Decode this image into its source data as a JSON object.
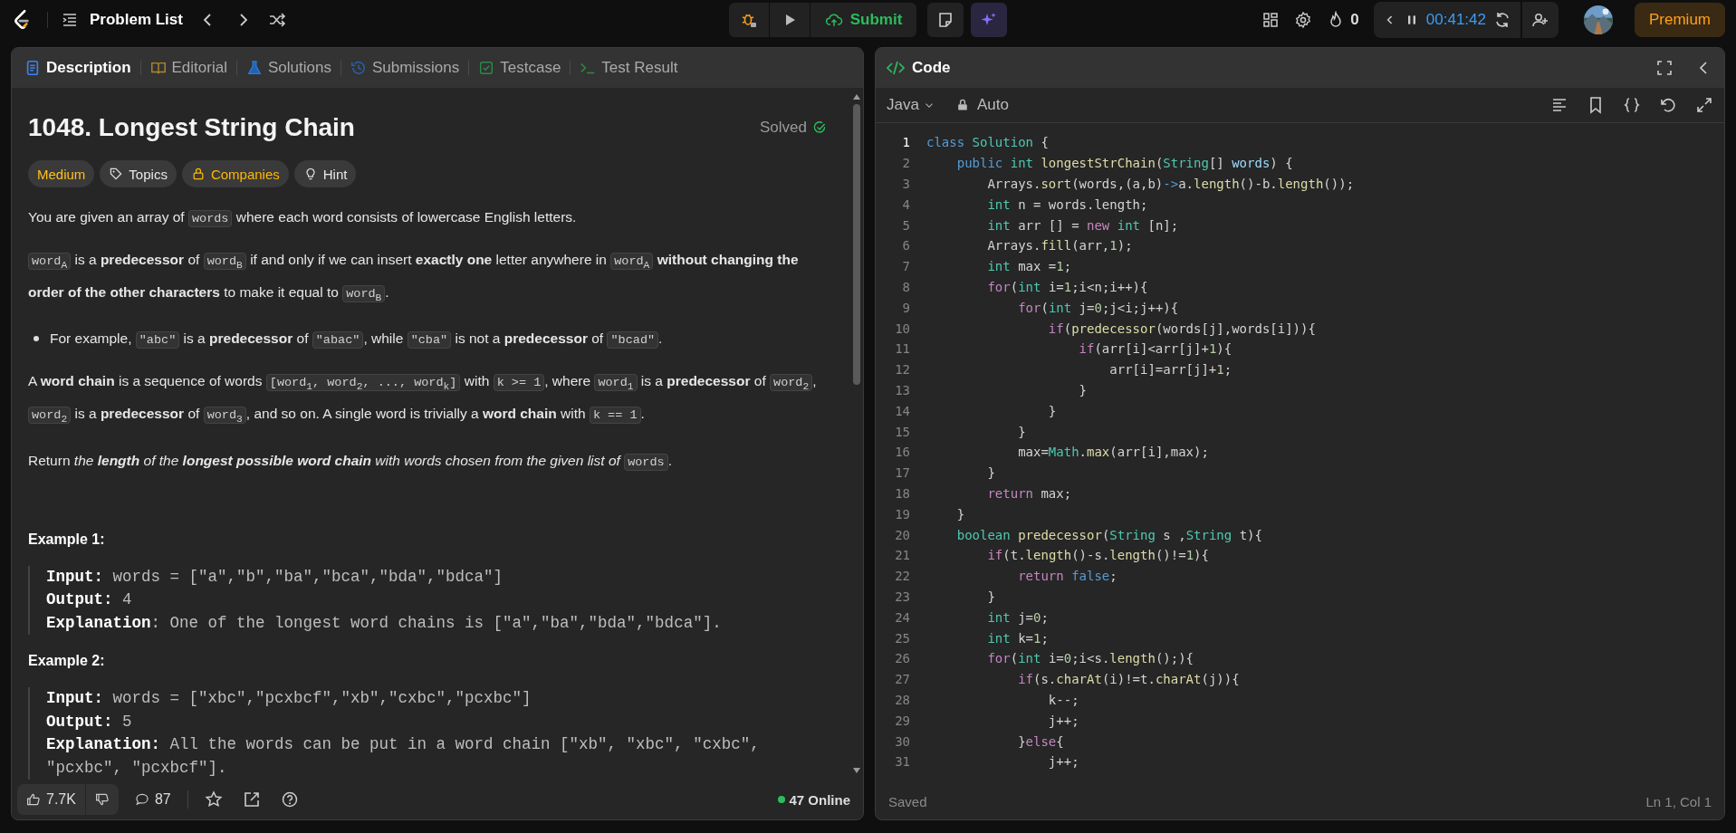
{
  "top_bar": {
    "problem_list": "Problem List",
    "submit": "Submit",
    "streak": "0",
    "timer": "00:41:42",
    "premium": "Premium"
  },
  "description_panel": {
    "tabs": [
      {
        "label": "Description",
        "selected": true
      },
      {
        "label": "Editorial",
        "selected": false
      },
      {
        "label": "Solutions",
        "selected": false
      },
      {
        "label": "Submissions",
        "selected": false
      },
      {
        "label": "Testcase",
        "selected": false
      },
      {
        "label": "Test Result",
        "selected": false
      }
    ],
    "title": "1048. Longest String Chain",
    "status": "Solved",
    "tags": [
      {
        "label": "Medium",
        "kind": "difficulty"
      },
      {
        "label": "Topics",
        "kind": "topics"
      },
      {
        "label": "Companies",
        "kind": "companies"
      },
      {
        "label": "Hint",
        "kind": "hint"
      }
    ],
    "paragraphs": [
      {
        "kind": "text",
        "segments": [
          {
            "text": "You are given an array of ",
            "kind": "text"
          },
          {
            "text": "words",
            "kind": "code"
          },
          {
            "text": " where each word consists of lowercase English letters.",
            "kind": "text"
          }
        ]
      },
      {
        "kind": "text",
        "segments": [
          {
            "text": "word$_{A}$",
            "kind": "code"
          },
          {
            "text": " is a **predecessor** of ",
            "kind": "text"
          },
          {
            "text": "word$_{B}$",
            "kind": "code"
          },
          {
            "text": " if and only if we can insert **exactly one** letter anywhere in ",
            "kind": "text"
          },
          {
            "text": "word$_{A}$",
            "kind": "code"
          },
          {
            "text": " **without changing the order of the other characters** to make it equal to ",
            "kind": "text"
          },
          {
            "text": "word$_{B}$",
            "kind": "code"
          },
          {
            "text": ".",
            "kind": "text"
          }
        ]
      },
      {
        "kind": "bullet",
        "segments": [
          {
            "text": "For example, ",
            "kind": "text"
          },
          {
            "text": "\"abc\"",
            "kind": "code"
          },
          {
            "text": " is a **predecessor** of ",
            "kind": "text"
          },
          {
            "text": "\"abac\"",
            "kind": "code"
          },
          {
            "text": ", while ",
            "kind": "text"
          },
          {
            "text": "\"cba\"",
            "kind": "code"
          },
          {
            "text": " is not a **predecessor** of ",
            "kind": "text"
          },
          {
            "text": "\"bcad\"",
            "kind": "code"
          },
          {
            "text": ".",
            "kind": "text"
          }
        ]
      },
      {
        "kind": "text",
        "segments": [
          {
            "text": "A **word chain** is a sequence of words ",
            "kind": "text"
          },
          {
            "text": "[word$_{1}$, word$_{2}$, ..., word$_{k}$]",
            "kind": "code"
          },
          {
            "text": " with ",
            "kind": "text"
          },
          {
            "text": "k >= 1",
            "kind": "code"
          },
          {
            "text": ", where ",
            "kind": "text"
          },
          {
            "text": "word$_{1}$",
            "kind": "code"
          },
          {
            "text": " is a **predecessor** of ",
            "kind": "text"
          },
          {
            "text": "word$_{2}$",
            "kind": "code"
          },
          {
            "text": ", ",
            "kind": "text"
          },
          {
            "text": "word$_{2}$",
            "kind": "code"
          },
          {
            "text": " is a **predecessor** of ",
            "kind": "text"
          },
          {
            "text": "word$_{3}$",
            "kind": "code"
          },
          {
            "text": ", and so on. A single word is trivially a **word chain** with ",
            "kind": "text"
          },
          {
            "text": "k == 1",
            "kind": "code"
          },
          {
            "text": ".",
            "kind": "text"
          }
        ]
      },
      {
        "kind": "text",
        "segments": [
          {
            "text": "Return ",
            "kind": "text"
          },
          {
            "text": "the **length** of the **longest possible word chain** with words chosen from the given list of ",
            "kind": "italic"
          },
          {
            "text": "words",
            "kind": "code"
          },
          {
            "text": ".",
            "kind": "text"
          }
        ]
      }
    ],
    "examples": [
      {
        "heading": "Example 1:",
        "lines": [
          "**Input:** words = [\"a\",\"b\",\"ba\",\"bca\",\"bda\",\"bdca\"]",
          "**Output:** 4",
          "**Explanation**: One of the longest word chains is [\"a\",\"ba\",\"bda\",\"bdca\"]."
        ]
      },
      {
        "heading": "Example 2:",
        "lines": [
          "**Input:** words = [\"xbc\",\"pcxbcf\",\"xb\",\"cxbc\",\"pcxbc\"]",
          "**Output:** 5",
          "**Explanation:** All the words can be put in a word chain [\"xb\", \"xbc\", \"cxbc\", \"pcxbc\", \"pcxbcf\"]."
        ]
      }
    ],
    "footer": {
      "likes": "7.7K",
      "comments": "87",
      "online": "47 Online"
    }
  },
  "code_panel": {
    "title": "Code",
    "language": "Java",
    "mode": "Auto",
    "status": "Saved",
    "cursor": "Ln 1, Col 1",
    "lines": [
      {
        "number": "1",
        "active": true,
        "tokens": [
          {
            "text": "class ",
            "kind": "st"
          },
          {
            "text": "Solution",
            "kind": "ty"
          },
          {
            "text": " {",
            "kind": "pl"
          }
        ]
      },
      {
        "number": "2",
        "active": false,
        "tokens": [
          {
            "text": "    public ",
            "kind": "st"
          },
          {
            "text": "int ",
            "kind": "ty"
          },
          {
            "text": "longestStrChain",
            "kind": "fn"
          },
          {
            "text": "(",
            "kind": "pl"
          },
          {
            "text": "String",
            "kind": "ty"
          },
          {
            "text": "[] ",
            "kind": "pl"
          },
          {
            "text": "words",
            "kind": "va"
          },
          {
            "text": ") {",
            "kind": "pl"
          }
        ]
      },
      {
        "number": "3",
        "active": false,
        "tokens": [
          {
            "text": "        Arrays.",
            "kind": "pl"
          },
          {
            "text": "sort",
            "kind": "fn"
          },
          {
            "text": "(words,(a,b)",
            "kind": "pl"
          },
          {
            "text": "->",
            "kind": "st"
          },
          {
            "text": "a.",
            "kind": "pl"
          },
          {
            "text": "length",
            "kind": "fn"
          },
          {
            "text": "()-b.",
            "kind": "pl"
          },
          {
            "text": "length",
            "kind": "fn"
          },
          {
            "text": "());",
            "kind": "pl"
          }
        ]
      },
      {
        "number": "4",
        "active": false,
        "tokens": [
          {
            "text": "        int ",
            "kind": "ty"
          },
          {
            "text": "n = words.length;",
            "kind": "pl"
          }
        ]
      },
      {
        "number": "5",
        "active": false,
        "tokens": [
          {
            "text": "        int ",
            "kind": "ty"
          },
          {
            "text": "arr [] = ",
            "kind": "pl"
          },
          {
            "text": "new ",
            "kind": "kw"
          },
          {
            "text": "int ",
            "kind": "ty"
          },
          {
            "text": "[n];",
            "kind": "pl"
          }
        ]
      },
      {
        "number": "6",
        "active": false,
        "tokens": [
          {
            "text": "        Arrays.",
            "kind": "pl"
          },
          {
            "text": "fill",
            "kind": "fn"
          },
          {
            "text": "(arr,",
            "kind": "pl"
          },
          {
            "text": "1",
            "kind": "nu"
          },
          {
            "text": ");",
            "kind": "pl"
          }
        ]
      },
      {
        "number": "7",
        "active": false,
        "tokens": [
          {
            "text": "        int ",
            "kind": "ty"
          },
          {
            "text": "max =",
            "kind": "pl"
          },
          {
            "text": "1",
            "kind": "nu"
          },
          {
            "text": ";",
            "kind": "pl"
          }
        ]
      },
      {
        "number": "8",
        "active": false,
        "tokens": [
          {
            "text": "        for",
            "kind": "kw"
          },
          {
            "text": "(",
            "kind": "pl"
          },
          {
            "text": "int ",
            "kind": "ty"
          },
          {
            "text": "i=",
            "kind": "pl"
          },
          {
            "text": "1",
            "kind": "nu"
          },
          {
            "text": ";i<n;i++){",
            "kind": "pl"
          }
        ]
      },
      {
        "number": "9",
        "active": false,
        "tokens": [
          {
            "text": "            for",
            "kind": "kw"
          },
          {
            "text": "(",
            "kind": "pl"
          },
          {
            "text": "int ",
            "kind": "ty"
          },
          {
            "text": "j=",
            "kind": "pl"
          },
          {
            "text": "0",
            "kind": "nu"
          },
          {
            "text": ";j<i;j++){",
            "kind": "pl"
          }
        ]
      },
      {
        "number": "10",
        "active": false,
        "tokens": [
          {
            "text": "                if",
            "kind": "kw"
          },
          {
            "text": "(",
            "kind": "pl"
          },
          {
            "text": "predecessor",
            "kind": "fn"
          },
          {
            "text": "(words[j],words[i])){",
            "kind": "pl"
          }
        ]
      },
      {
        "number": "11",
        "active": false,
        "tokens": [
          {
            "text": "                    if",
            "kind": "kw"
          },
          {
            "text": "(arr[i]<arr[j]+",
            "kind": "pl"
          },
          {
            "text": "1",
            "kind": "nu"
          },
          {
            "text": "){",
            "kind": "pl"
          }
        ]
      },
      {
        "number": "12",
        "active": false,
        "tokens": [
          {
            "text": "                        arr[i]=arr[j]+",
            "kind": "pl"
          },
          {
            "text": "1",
            "kind": "nu"
          },
          {
            "text": ";",
            "kind": "pl"
          }
        ]
      },
      {
        "number": "13",
        "active": false,
        "tokens": [
          {
            "text": "                    }",
            "kind": "pl"
          }
        ]
      },
      {
        "number": "14",
        "active": false,
        "tokens": [
          {
            "text": "                }",
            "kind": "pl"
          }
        ]
      },
      {
        "number": "15",
        "active": false,
        "tokens": [
          {
            "text": "            }",
            "kind": "pl"
          }
        ]
      },
      {
        "number": "16",
        "active": false,
        "tokens": [
          {
            "text": "            max=",
            "kind": "pl"
          },
          {
            "text": "Math",
            "kind": "ty"
          },
          {
            "text": ".",
            "kind": "pl"
          },
          {
            "text": "max",
            "kind": "fn"
          },
          {
            "text": "(arr[i],max);",
            "kind": "pl"
          }
        ]
      },
      {
        "number": "17",
        "active": false,
        "tokens": [
          {
            "text": "        }",
            "kind": "pl"
          }
        ]
      },
      {
        "number": "18",
        "active": false,
        "tokens": [
          {
            "text": "        return ",
            "kind": "kw"
          },
          {
            "text": "max;",
            "kind": "pl"
          }
        ]
      },
      {
        "number": "19",
        "active": false,
        "tokens": [
          {
            "text": "    }",
            "kind": "pl"
          }
        ]
      },
      {
        "number": "20",
        "active": false,
        "tokens": [
          {
            "text": "    boolean ",
            "kind": "ty"
          },
          {
            "text": "predecessor",
            "kind": "fn"
          },
          {
            "text": "(",
            "kind": "pl"
          },
          {
            "text": "String ",
            "kind": "ty"
          },
          {
            "text": "s ,",
            "kind": "pl"
          },
          {
            "text": "String ",
            "kind": "ty"
          },
          {
            "text": "t){",
            "kind": "pl"
          }
        ]
      },
      {
        "number": "21",
        "active": false,
        "tokens": [
          {
            "text": "        if",
            "kind": "kw"
          },
          {
            "text": "(t.",
            "kind": "pl"
          },
          {
            "text": "length",
            "kind": "fn"
          },
          {
            "text": "()-s.",
            "kind": "pl"
          },
          {
            "text": "length",
            "kind": "fn"
          },
          {
            "text": "()!=",
            "kind": "pl"
          },
          {
            "text": "1",
            "kind": "nu"
          },
          {
            "text": "){",
            "kind": "pl"
          }
        ]
      },
      {
        "number": "22",
        "active": false,
        "tokens": [
          {
            "text": "            return ",
            "kind": "kw"
          },
          {
            "text": "false",
            "kind": "st"
          },
          {
            "text": ";",
            "kind": "pl"
          }
        ]
      },
      {
        "number": "23",
        "active": false,
        "tokens": [
          {
            "text": "        }",
            "kind": "pl"
          }
        ]
      },
      {
        "number": "24",
        "active": false,
        "tokens": [
          {
            "text": "        int ",
            "kind": "ty"
          },
          {
            "text": "j=",
            "kind": "pl"
          },
          {
            "text": "0",
            "kind": "nu"
          },
          {
            "text": ";",
            "kind": "pl"
          }
        ]
      },
      {
        "number": "25",
        "active": false,
        "tokens": [
          {
            "text": "        int ",
            "kind": "ty"
          },
          {
            "text": "k=",
            "kind": "pl"
          },
          {
            "text": "1",
            "kind": "nu"
          },
          {
            "text": ";",
            "kind": "pl"
          }
        ]
      },
      {
        "number": "26",
        "active": false,
        "tokens": [
          {
            "text": "        for",
            "kind": "kw"
          },
          {
            "text": "(",
            "kind": "pl"
          },
          {
            "text": "int ",
            "kind": "ty"
          },
          {
            "text": "i=",
            "kind": "pl"
          },
          {
            "text": "0",
            "kind": "nu"
          },
          {
            "text": ";i<s.",
            "kind": "pl"
          },
          {
            "text": "length",
            "kind": "fn"
          },
          {
            "text": "();){",
            "kind": "pl"
          }
        ]
      },
      {
        "number": "27",
        "active": false,
        "tokens": [
          {
            "text": "            if",
            "kind": "kw"
          },
          {
            "text": "(s.",
            "kind": "pl"
          },
          {
            "text": "charAt",
            "kind": "fn"
          },
          {
            "text": "(i)!=t.",
            "kind": "pl"
          },
          {
            "text": "charAt",
            "kind": "fn"
          },
          {
            "text": "(j)){",
            "kind": "pl"
          }
        ]
      },
      {
        "number": "28",
        "active": false,
        "tokens": [
          {
            "text": "                k--;",
            "kind": "pl"
          }
        ]
      },
      {
        "number": "29",
        "active": false,
        "tokens": [
          {
            "text": "                j++;",
            "kind": "pl"
          }
        ]
      },
      {
        "number": "30",
        "active": false,
        "tokens": [
          {
            "text": "            }",
            "kind": "pl"
          },
          {
            "text": "else",
            "kind": "kw"
          },
          {
            "text": "{",
            "kind": "pl"
          }
        ]
      },
      {
        "number": "31",
        "active": false,
        "tokens": [
          {
            "text": "                j++;",
            "kind": "pl"
          }
        ]
      }
    ]
  }
}
